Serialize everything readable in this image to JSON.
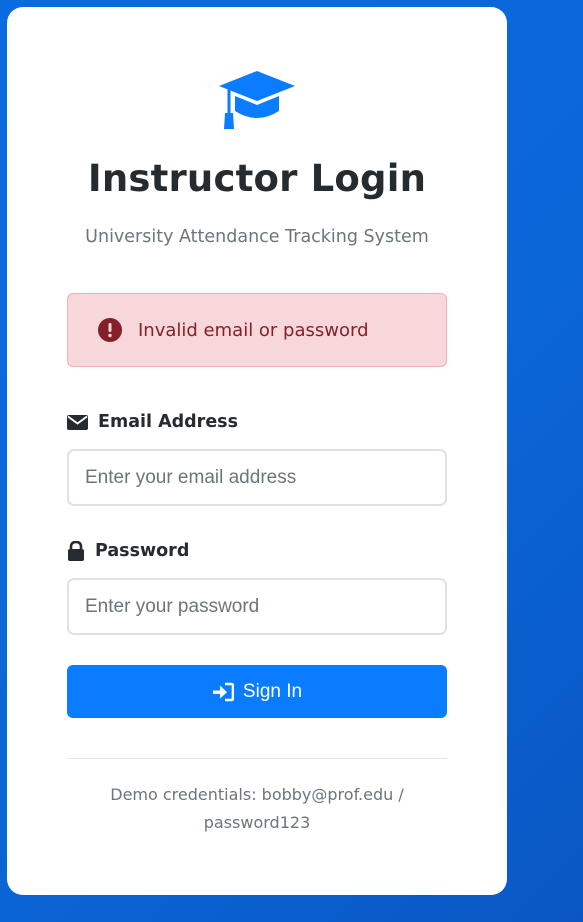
{
  "header": {
    "logo_icon": "graduation-cap-icon",
    "title": "Instructor Login",
    "subtitle": "University Attendance Tracking System"
  },
  "alert": {
    "icon": "exclamation-circle-icon",
    "message": "Invalid email or password",
    "color": "#842029",
    "background": "#f8d7da"
  },
  "form": {
    "email": {
      "icon": "envelope-icon",
      "label": "Email Address",
      "value": "",
      "placeholder": "Enter your email address"
    },
    "password": {
      "icon": "lock-icon",
      "label": "Password",
      "value": "",
      "placeholder": "Enter your password"
    },
    "submit": {
      "icon": "sign-in-icon",
      "label": "Sign In"
    }
  },
  "footer": {
    "line1": "Demo credentials: bobby@prof.edu /",
    "line2": "password123"
  },
  "colors": {
    "accent": "#0a7cff",
    "background": "#0b66d8",
    "text": "#262b30",
    "muted": "#6c757d"
  }
}
